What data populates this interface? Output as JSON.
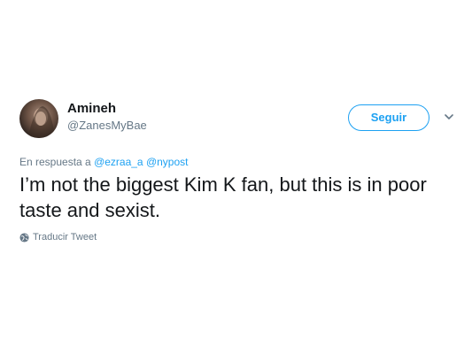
{
  "user": {
    "name": "Amineh",
    "handle": "@ZanesMyBae",
    "avatar_icon": "user-avatar-photo"
  },
  "follow_button": {
    "label": "Seguir"
  },
  "menu_icon": "chevron-down-icon",
  "reply": {
    "prefix": "En respuesta a",
    "mentions": [
      "@ezraa_a",
      "@nypost"
    ]
  },
  "tweet_text": "I’m not the biggest Kim K fan, but this is in poor taste and sexist.",
  "translate": {
    "label": "Traducir Tweet",
    "icon": "globe-icon"
  },
  "colors": {
    "accent": "#1da1f2",
    "secondary_text": "#657786",
    "primary_text": "#14171a"
  }
}
